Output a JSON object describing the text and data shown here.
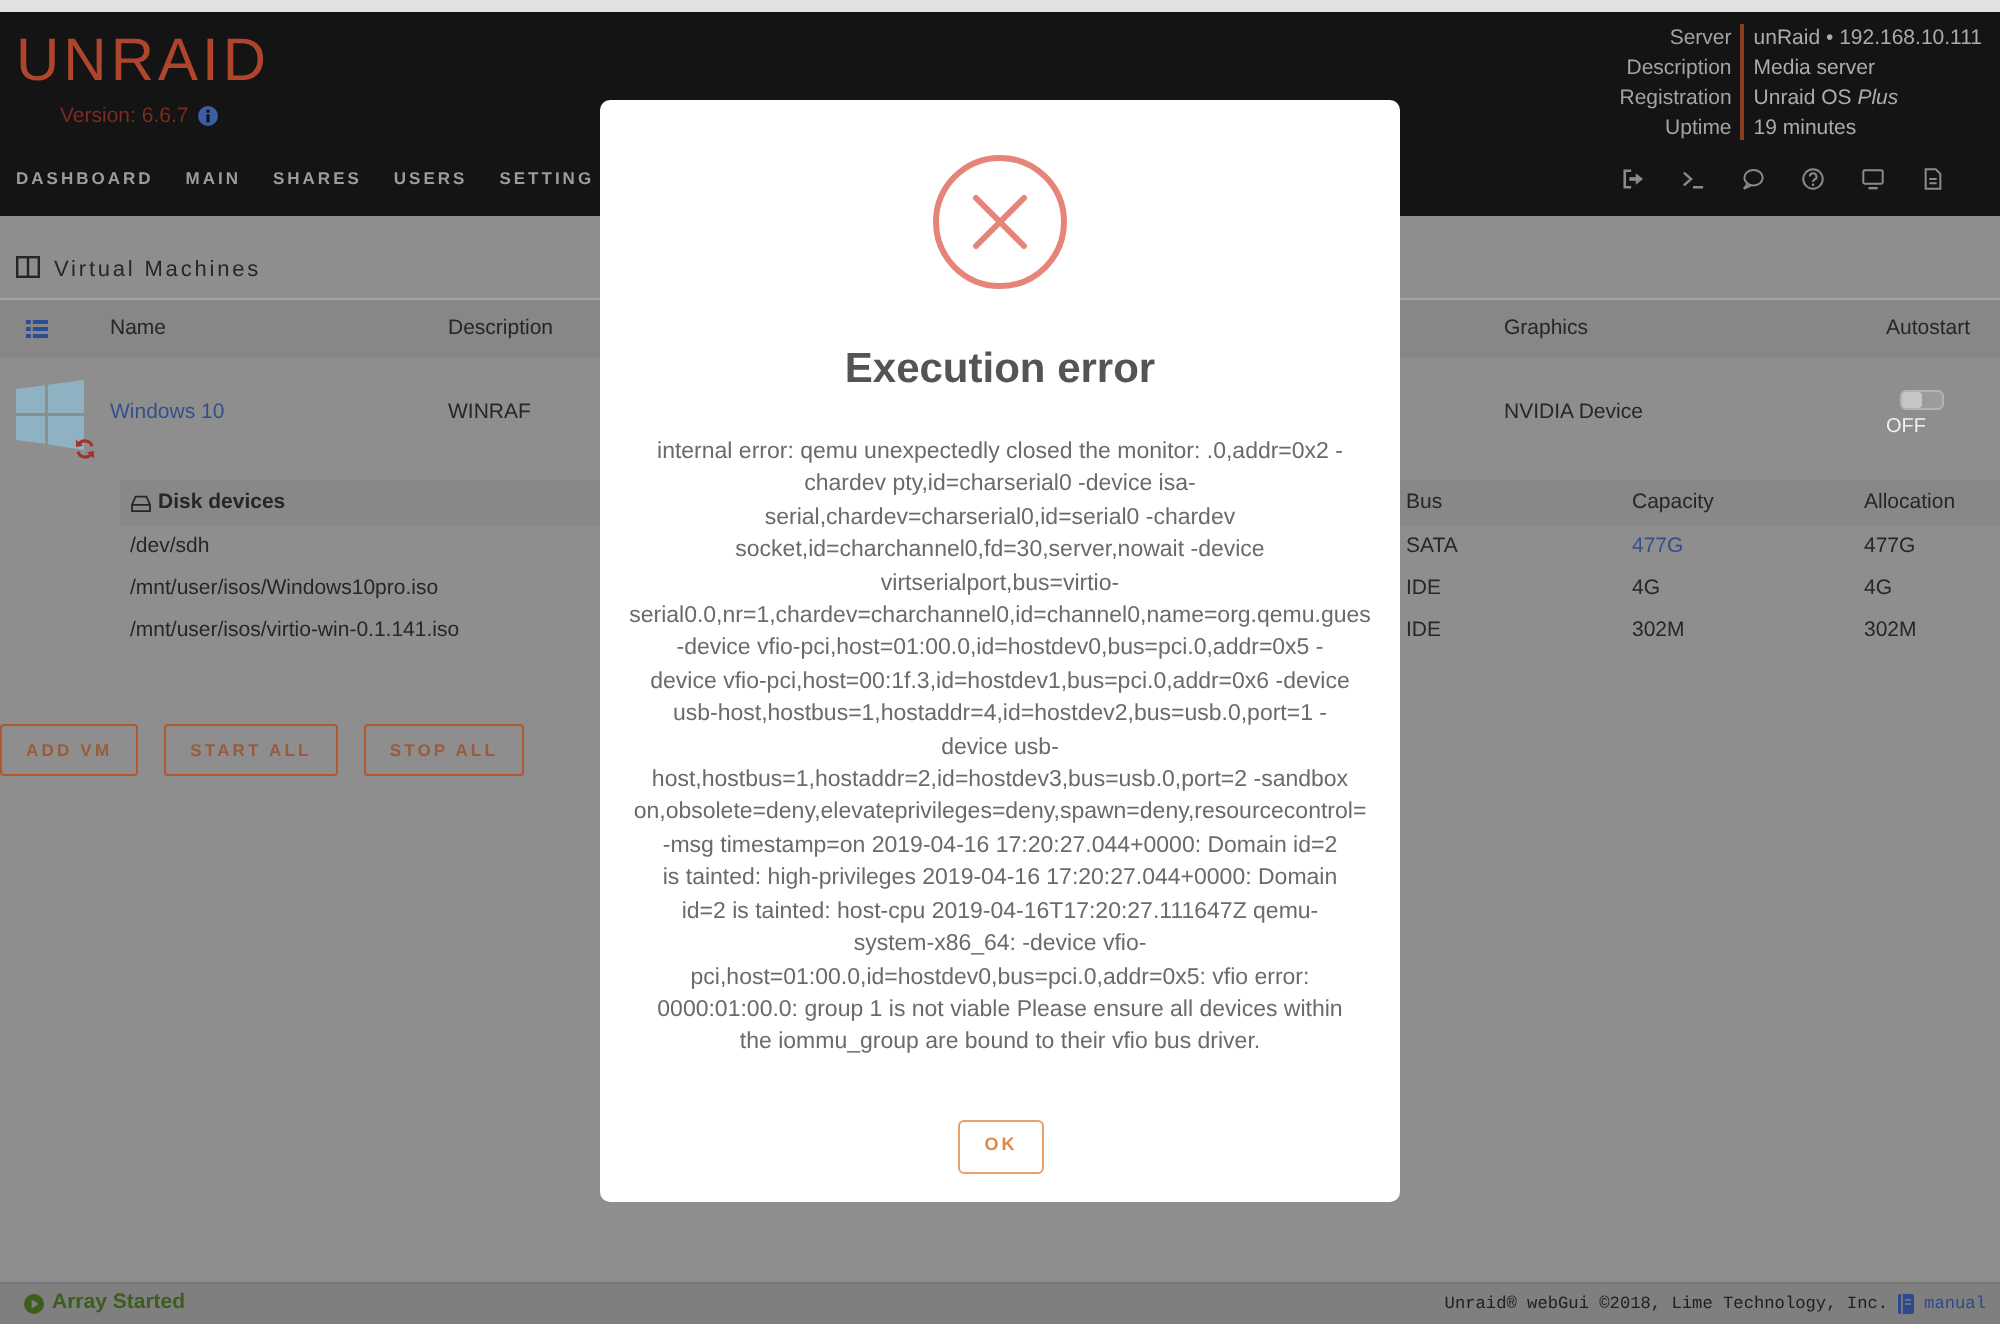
{
  "header": {
    "logo": "UNRAID",
    "version": "Version: 6.6.7",
    "nav": [
      "DASHBOARD",
      "MAIN",
      "SHARES",
      "USERS",
      "SETTING"
    ],
    "server_info": [
      {
        "label": "Server",
        "value": "unRaid • 192.168.10.111"
      },
      {
        "label": "Description",
        "value": "Media server"
      },
      {
        "label": "Registration",
        "value": "Unraid OS *Plus*"
      },
      {
        "label": "Uptime",
        "value": "19 minutes"
      }
    ]
  },
  "vm_section": {
    "title": "Virtual Machines",
    "columns": [
      "Name",
      "Description",
      "Graphics",
      "Autostart"
    ],
    "vms": [
      {
        "name": "Windows 10",
        "description": "WINRAF",
        "graphics": "NVIDIA Device",
        "autostart": false,
        "autostart_label": "OFF",
        "disks": {
          "title": "Disk devices",
          "columns": [
            "Bus",
            "Capacity",
            "Allocation"
          ],
          "rows": [
            {
              "path": "/dev/sdh",
              "bus": "SATA",
              "capacity": "477G",
              "capacity_link": true,
              "allocation": "477G"
            },
            {
              "path": "/mnt/user/isos/Windows10pro.iso",
              "bus": "IDE",
              "capacity": "4G",
              "capacity_link": false,
              "allocation": "4G"
            },
            {
              "path": "/mnt/user/isos/virtio-win-0.1.141.iso",
              "bus": "IDE",
              "capacity": "302M",
              "capacity_link": false,
              "allocation": "302M"
            }
          ]
        }
      }
    ]
  },
  "buttons": [
    "ADD VM",
    "START ALL",
    "STOP ALL"
  ],
  "dialog": {
    "title": "Execution error",
    "message_lines": [
      "internal error: qemu unexpectedly closed the monitor: .0,addr=0x2 -",
      "chardev pty,id=charserial0 -device isa-",
      "serial,chardev=charserial0,id=serial0 -chardev",
      "socket,id=charchannel0,fd=30,server,nowait -device",
      "virtserialport,bus=virtio-",
      "serial0.0,nr=1,chardev=charchannel0,id=channel0,name=org.qemu.gues",
      "-device vfio-pci,host=01:00.0,id=hostdev0,bus=pci.0,addr=0x5 -",
      "device vfio-pci,host=00:1f.3,id=hostdev1,bus=pci.0,addr=0x6 -device",
      "usb-host,hostbus=1,hostaddr=4,id=hostdev2,bus=usb.0,port=1 -",
      "device usb-",
      "host,hostbus=1,hostaddr=2,id=hostdev3,bus=usb.0,port=2 -sandbox",
      "on,obsolete=deny,elevateprivileges=deny,spawn=deny,resourcecontrol=",
      "-msg timestamp=on 2019-04-16 17:20:27.044+0000: Domain id=2",
      "is tainted: high-privileges 2019-04-16 17:20:27.044+0000: Domain",
      "id=2 is tainted: host-cpu 2019-04-16T17:20:27.111647Z qemu-",
      "system-x86_64: -device vfio-",
      "pci,host=01:00.0,id=hostdev0,bus=pci.0,addr=0x5: vfio error:",
      "0000:01:00.0: group 1 is not viable Please ensure all devices within",
      "the iommu_group are bound to their vfio bus driver."
    ],
    "button": "OK"
  },
  "status_bar": {
    "status": "Array Started",
    "copyright": "Unraid® webGui ©2018, Lime Technology, Inc.",
    "link": "manual"
  }
}
